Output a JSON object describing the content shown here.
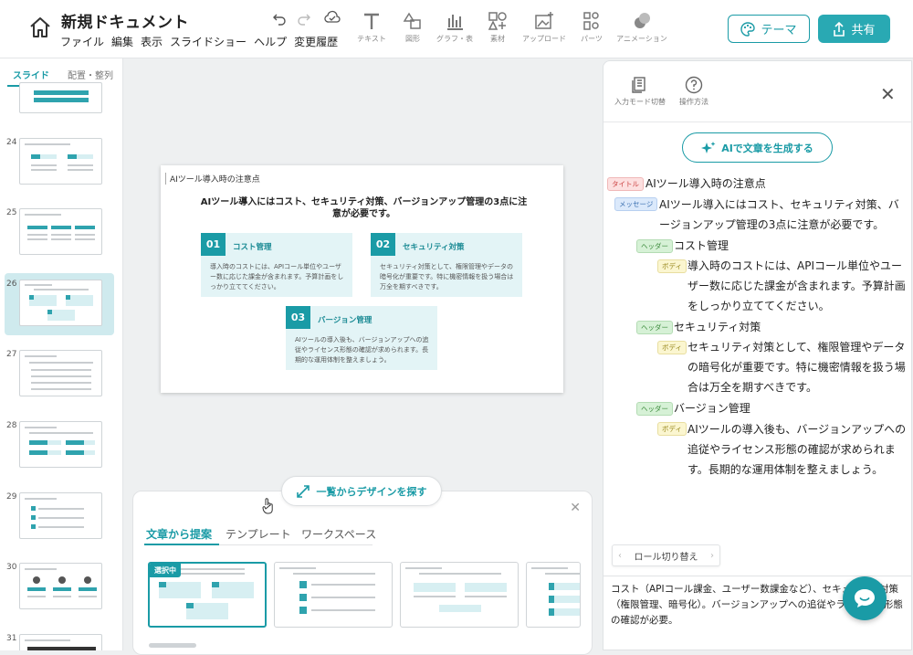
{
  "app": {
    "doc_title": "新規ドキュメント",
    "menu": [
      "ファイル",
      "編集",
      "表示",
      "スライドショー",
      "ヘルプ",
      "変更履歴"
    ],
    "tools": [
      "テキスト",
      "図形",
      "グラフ・表",
      "素材",
      "アップロード",
      "パーツ",
      "アニメーション"
    ],
    "theme_label": "テーマ",
    "share_label": "共有",
    "accent": "#1a9ba6"
  },
  "sidebar": {
    "tabs": [
      "スライド",
      "配置・整列"
    ],
    "slide_numbers": [
      "24",
      "25",
      "26",
      "27",
      "28",
      "29",
      "30",
      "31"
    ],
    "selected": "26"
  },
  "slide": {
    "title": "AIツール導入時の注意点",
    "message": "AIツール導入にはコスト、セキュリティ対策、バージョンアップ管理の3点に注意が必要です。",
    "cards": [
      {
        "num": "01",
        "head": "コスト管理",
        "body": "導入時のコストには、APIコール単位やユーザー数に応じた課金が含まれます。予算計画をしっかり立ててください。"
      },
      {
        "num": "02",
        "head": "セキュリティ対策",
        "body": "セキュリティ対策として、権限管理やデータの暗号化が重要です。特に機密情報を扱う場合は万全を期すべきです。"
      },
      {
        "num": "03",
        "head": "バージョン管理",
        "body": "AIツールの導入後も、バージョンアップへの追従やライセンス形態の確認が求められます。長期的な運用体制を整えましょう。"
      }
    ]
  },
  "explore_label": "一覧からデザインを探す",
  "bottom_panel": {
    "tabs": [
      "文章から提案",
      "テンプレート",
      "ワークスペース"
    ],
    "selected_badge": "選択中"
  },
  "right_panel": {
    "icons": [
      "入力モード切替",
      "操作方法"
    ],
    "ai_button": "AIで文章を生成する",
    "tags": {
      "title": "タイトル",
      "message": "メッセージ",
      "header": "ヘッダー",
      "body": "ボディ"
    },
    "role_switch": "ロール切り替え",
    "note": "コスト（APIコール課金、ユーザー数課金など）、セキュリティ対策（権限管理、暗号化）。バージョンアップへの追従やライセンス形態の確認が必要。"
  }
}
